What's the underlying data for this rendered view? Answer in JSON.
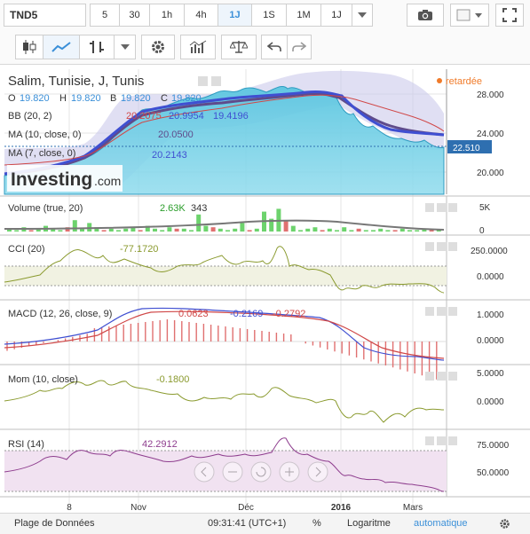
{
  "toolbar": {
    "symbol": "TND5",
    "timeframes": [
      "5",
      "30",
      "1h",
      "4h",
      "1J",
      "1S",
      "1M",
      "1J"
    ],
    "active_timeframe": "1J"
  },
  "header": {
    "title": "Salim, Tunisie, J, Tunis",
    "ohlc": {
      "o_label": "O",
      "o": "19.820",
      "h_label": "H",
      "h": "19.820",
      "b_label": "B",
      "b": "19.820",
      "c_label": "C",
      "c": "19.820"
    },
    "status": "retardée",
    "bb_label": "BB (20, 2)",
    "bb_values": [
      "20.2075",
      "20.9954",
      "19.4196"
    ],
    "ma10_label": "MA (10, close, 0)",
    "ma10_value": "20.0500",
    "ma7_label": "MA (7, close, 0)",
    "ma7_value": "20.2143",
    "watermark": "Investing",
    "watermark_suffix": ".com"
  },
  "panels": {
    "volume": {
      "label": "Volume (true, 20)",
      "v1": "2.63K",
      "v2": "343"
    },
    "cci": {
      "label": "CCI (20)",
      "value": "-77.1720"
    },
    "macd": {
      "label": "MACD (12, 26, close, 9)",
      "v1": "0.0623",
      "v2": "-0.2169",
      "v3": "-0.2792"
    },
    "mom": {
      "label": "Mom (10, close)",
      "value": "-0.1800"
    },
    "rsi": {
      "label": "RSI (14)",
      "value": "42.2912"
    }
  },
  "axes": {
    "price_ticks": [
      "28.000",
      "24.000",
      "20.000"
    ],
    "current_price": "22.510",
    "volume_ticks": [
      "5K",
      "0"
    ],
    "cci_ticks": [
      "250.0000",
      "0.0000"
    ],
    "macd_ticks": [
      "1.0000",
      "0.0000"
    ],
    "mom_ticks": [
      "5.0000",
      "0.0000"
    ],
    "rsi_ticks": [
      "75.0000",
      "50.0000"
    ],
    "time_ticks": [
      "8",
      "Nov",
      "Déc",
      "2016",
      "Mars"
    ]
  },
  "footer": {
    "range_label": "Plage de Données",
    "time": "09:31:41 (UTC+1)",
    "percent": "%",
    "log": "Logaritme",
    "auto": "automatique"
  },
  "colors": {
    "accent": "#3a8fd8",
    "price_area": "#6fd0e6",
    "ma": "#3f4fd1",
    "bb": "#d04848",
    "cci": "#8a9a2e",
    "rsi": "#8e3d8e"
  },
  "chart_data": {
    "type": "line",
    "title": "Salim, Tunisie, J, Tunis",
    "x": [
      "8",
      "Nov",
      "Déc",
      "2016",
      "Mars"
    ],
    "price": {
      "ylim": [
        18.5,
        29.5
      ],
      "close": [
        19.2,
        19.5,
        20.1,
        21.5,
        24.5,
        25.5,
        26.0,
        26.2,
        26.8,
        27.5,
        28.0,
        27.0,
        25.0,
        24.2,
        23.0,
        22.5
      ]
    },
    "volume": {
      "ylim": [
        0,
        6000
      ],
      "unit": "K"
    },
    "cci": {
      "ylim": [
        -150,
        350
      ],
      "last": -77.172
    },
    "macd": {
      "ylim": [
        -0.8,
        1.3
      ],
      "values": [
        0.0623,
        -0.2169,
        -0.2792
      ]
    },
    "mom": {
      "ylim": [
        -2,
        6
      ],
      "last": -0.18
    },
    "rsi": {
      "ylim": [
        30,
        85
      ],
      "last": 42.2912
    }
  }
}
